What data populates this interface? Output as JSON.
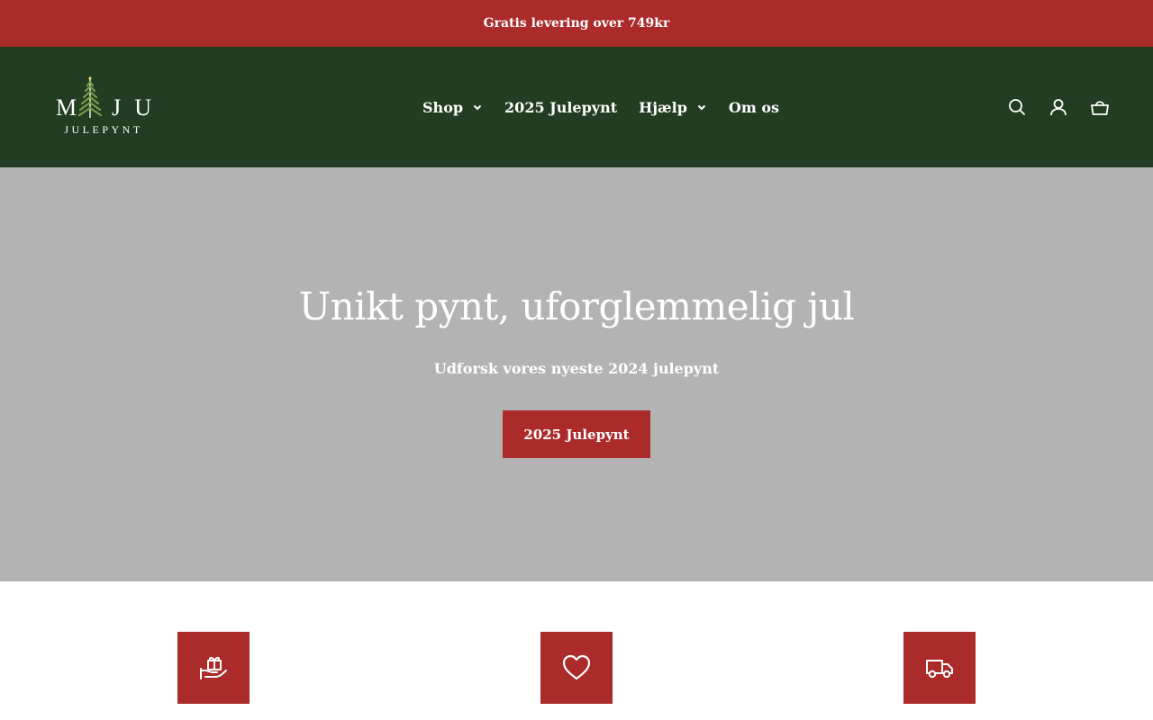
{
  "announcement": {
    "text": "Gratis levering over 749kr"
  },
  "logo": {
    "letters": [
      "M",
      "I",
      "J",
      "U"
    ],
    "subtitle": "JULEPYNT"
  },
  "nav": {
    "items": [
      {
        "label": "Shop",
        "has_dropdown": true
      },
      {
        "label": "2025 Julepynt",
        "has_dropdown": false
      },
      {
        "label": "Hjælp",
        "has_dropdown": true
      },
      {
        "label": "Om os",
        "has_dropdown": false
      }
    ]
  },
  "header_icons": [
    "search-icon",
    "account-icon",
    "cart-icon"
  ],
  "hero": {
    "title": "Unikt pynt, uforglemmelig jul",
    "subtitle": "Udforsk vores nyeste 2024 julepynt",
    "button_label": "2025 Julepynt"
  },
  "features": {
    "icons": [
      "gift-hand-icon",
      "heart-icon",
      "truck-icon"
    ]
  },
  "colors": {
    "announcement_bg": "#ab2a2a",
    "header_bg": "#223d21",
    "hero_bg": "#b3b3b3",
    "accent": "#ab2a2a",
    "tree_green": "#7a9a4a"
  }
}
